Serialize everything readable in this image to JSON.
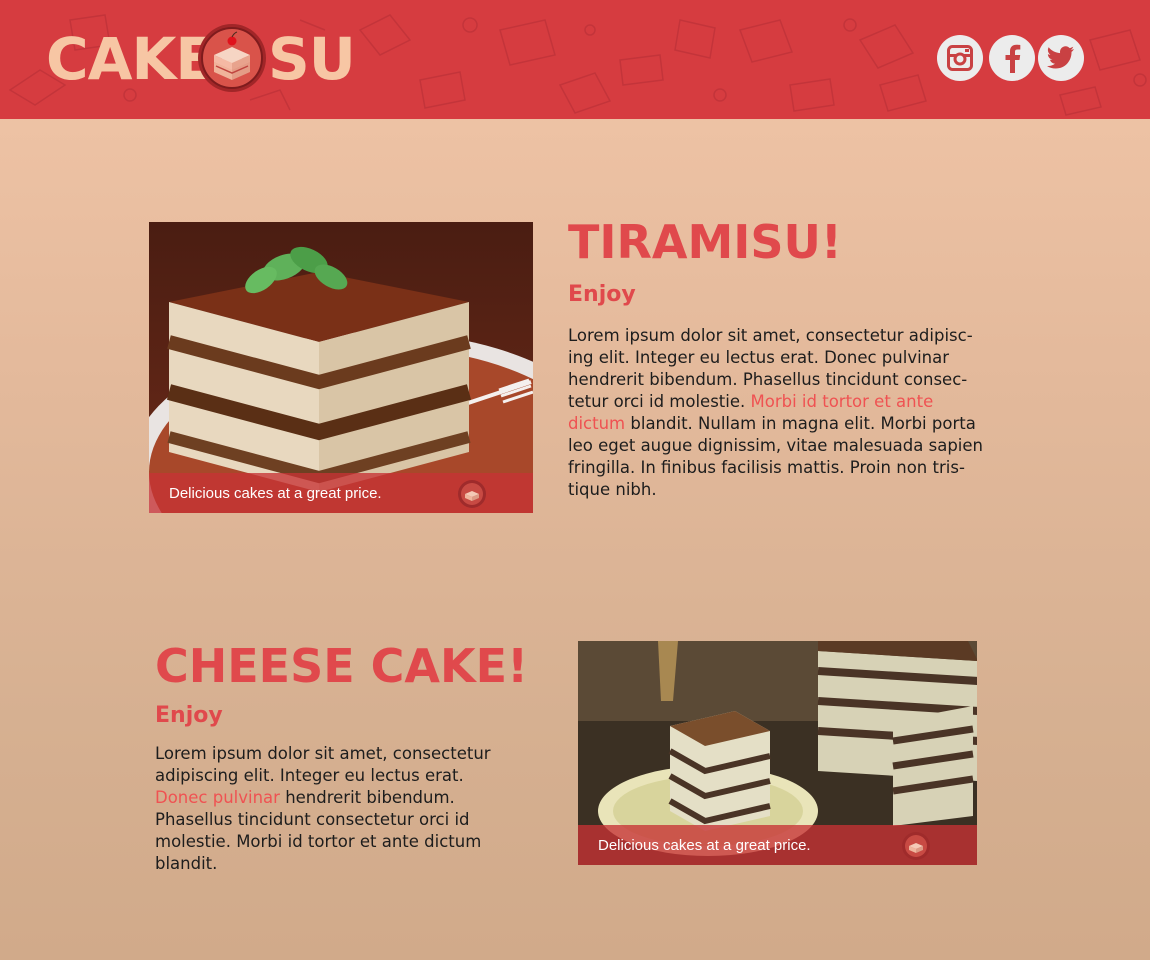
{
  "header": {
    "logo": {
      "left_text": "CAKE",
      "right_text": "SU"
    },
    "social": [
      {
        "icon": "instagram-icon",
        "label": "Instagram"
      },
      {
        "icon": "facebook-icon",
        "label": "Facebook"
      },
      {
        "icon": "twitter-icon",
        "label": "Twitter"
      }
    ]
  },
  "sections": [
    {
      "title": "TIRAMISU!",
      "subtitle": "Enjoy",
      "body_before": "Lorem ipsum dolor sit amet, consectetur adipisc­ing elit. Integer eu lectus erat. Donec pulvinar hendrerit bibendum. Phasellus tincidunt consec­tetur orci id molestie. ",
      "link": "Morbi id tortor et ante dictum",
      "body_after": " blandit. Nullam in magna elit. Morbi porta leo eget augue dignissim, vitae malesuada sapien fringilla. In finibus facilisis mattis. Proin non tris­tique nibh.",
      "caption": "Delicious cakes at a great price."
    },
    {
      "title": "CHEESE CAKE!",
      "subtitle": "Enjoy",
      "body_before": "Lorem ipsum dolor sit amet, consectetur adipiscing elit. Integer eu lectus erat. ",
      "link": "Donec pulvinar",
      "body_after": " hendrerit bibendum. Phasellus tincidunt consectetur orci id molestie. Morbi id tortor et ante dictum blandit.",
      "caption": "Delicious cakes at a great price."
    }
  ],
  "colors": {
    "header": "#d63c40",
    "accent": "#e0494c",
    "link": "#ef5252",
    "logo_text": "#f7c6a4"
  }
}
